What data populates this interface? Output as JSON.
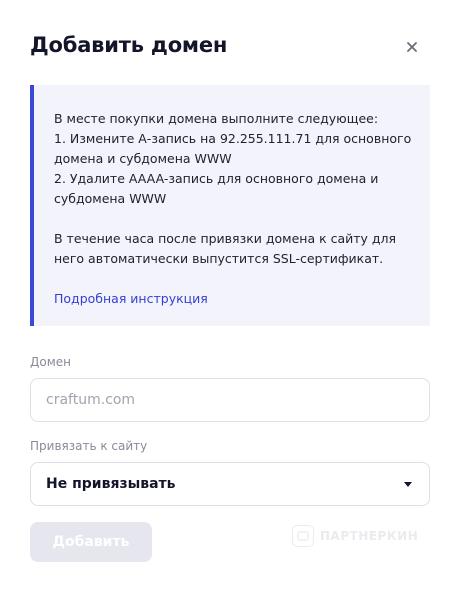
{
  "dialog": {
    "title": "Добавить домен",
    "close_icon": "close-icon"
  },
  "info": {
    "line1": "В месте покупки домена выполните следующее:",
    "line2": "1. Измените А-запись на 92.255.111.71 для основного домена и субдомена WWW",
    "line3": "2. Удалите AAAA-запись для основного домена и субдомена WWW",
    "line4": "В течение часа после привязки домена к сайту для него автоматически выпустится SSL-сертификат.",
    "link": "Подробная инструкция"
  },
  "domain_field": {
    "label": "Домен",
    "value": "",
    "placeholder": "craftum.com"
  },
  "site_select": {
    "label": "Привязать к сайту",
    "selected": "Не привязывать"
  },
  "submit": {
    "label": "Добавить",
    "disabled": true
  },
  "watermark": {
    "text": "ПАРТНЕРКИН"
  },
  "colors": {
    "accent": "#3d47d6",
    "info_bg": "#f3f3fb",
    "button_disabled": "#e6e6ee"
  }
}
